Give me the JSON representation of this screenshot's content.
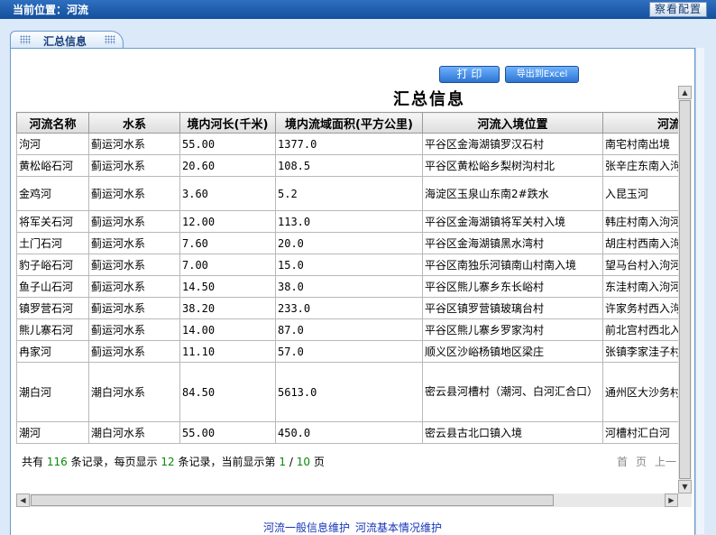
{
  "topbar": {
    "location": "当前位置：河流",
    "config_button": "察看配置"
  },
  "tab": {
    "title": "汇总信息"
  },
  "actions": {
    "print": "打 印",
    "export": "导出到Excel"
  },
  "page_title": "汇总信息",
  "table": {
    "headers": [
      "河流名称",
      "水系",
      "境内河长(千米)",
      "境内流域面积(平方公里)",
      "河流入境位置",
      "河流"
    ],
    "rows": [
      [
        "泃河",
        "蓟运河水系",
        "55.00",
        "1377.0",
        "平谷区金海湖镇罗汉石村",
        "南宅村南出境"
      ],
      [
        "黄松峪石河",
        "蓟运河水系",
        "20.60",
        "108.5",
        "平谷区黄松峪乡梨树沟村北",
        "张辛庄东南入泃"
      ],
      [
        "金鸡河",
        "蓟运河水系",
        "3.60",
        "5.2",
        "海淀区玉泉山东南2#跌水",
        "入昆玉河"
      ],
      [
        "将军关石河",
        "蓟运河水系",
        "12.00",
        "113.0",
        "平谷区金海湖镇将军关村入境",
        "韩庄村南入泃河"
      ],
      [
        "土门石河",
        "蓟运河水系",
        "7.60",
        "20.0",
        "平谷区金海湖镇黑水湾村",
        "胡庄村西南入泃"
      ],
      [
        "豹子峪石河",
        "蓟运河水系",
        "7.00",
        "15.0",
        "平谷区南独乐河镇南山村南入境",
        "望马台村入泃河"
      ],
      [
        "鱼子山石河",
        "蓟运河水系",
        "14.50",
        "38.0",
        "平谷区熊儿寨乡东长峪村",
        "东洼村南入泃河"
      ],
      [
        "镇罗营石河",
        "蓟运河水系",
        "38.20",
        "233.0",
        "平谷区镇罗营镇玻璃台村",
        "许家务村西入泃"
      ],
      [
        "熊儿寨石河",
        "蓟运河水系",
        "14.00",
        "87.0",
        "平谷区熊儿寨乡罗家沟村",
        "前北宫村西北入"
      ],
      [
        "冉家河",
        "蓟运河水系",
        "11.10",
        "57.0",
        "顺义区沙峪杨镇地区梁庄",
        "张镇李家洼子村"
      ],
      [
        "潮白河",
        "潮白河水系",
        "84.50",
        "5613.0",
        "密云县河槽村（潮河、白河汇合口）",
        "通州区大沙务村"
      ],
      [
        "潮河",
        "潮白河水系",
        "55.00",
        "450.0",
        "密云县古北口镇入境",
        "河槽村汇白河"
      ]
    ]
  },
  "pagination": {
    "prefix": "共有",
    "total": "116",
    "mid1": "条记录，每页显示",
    "per_page": "12",
    "mid2": "条记录，当前显示第",
    "current": "1",
    "sep": "/",
    "pages": "10",
    "suffix": "页",
    "first": "首",
    "page": "页",
    "prev": "上一"
  },
  "links": [
    "河流一般信息维护",
    "河流基本情况维护"
  ]
}
